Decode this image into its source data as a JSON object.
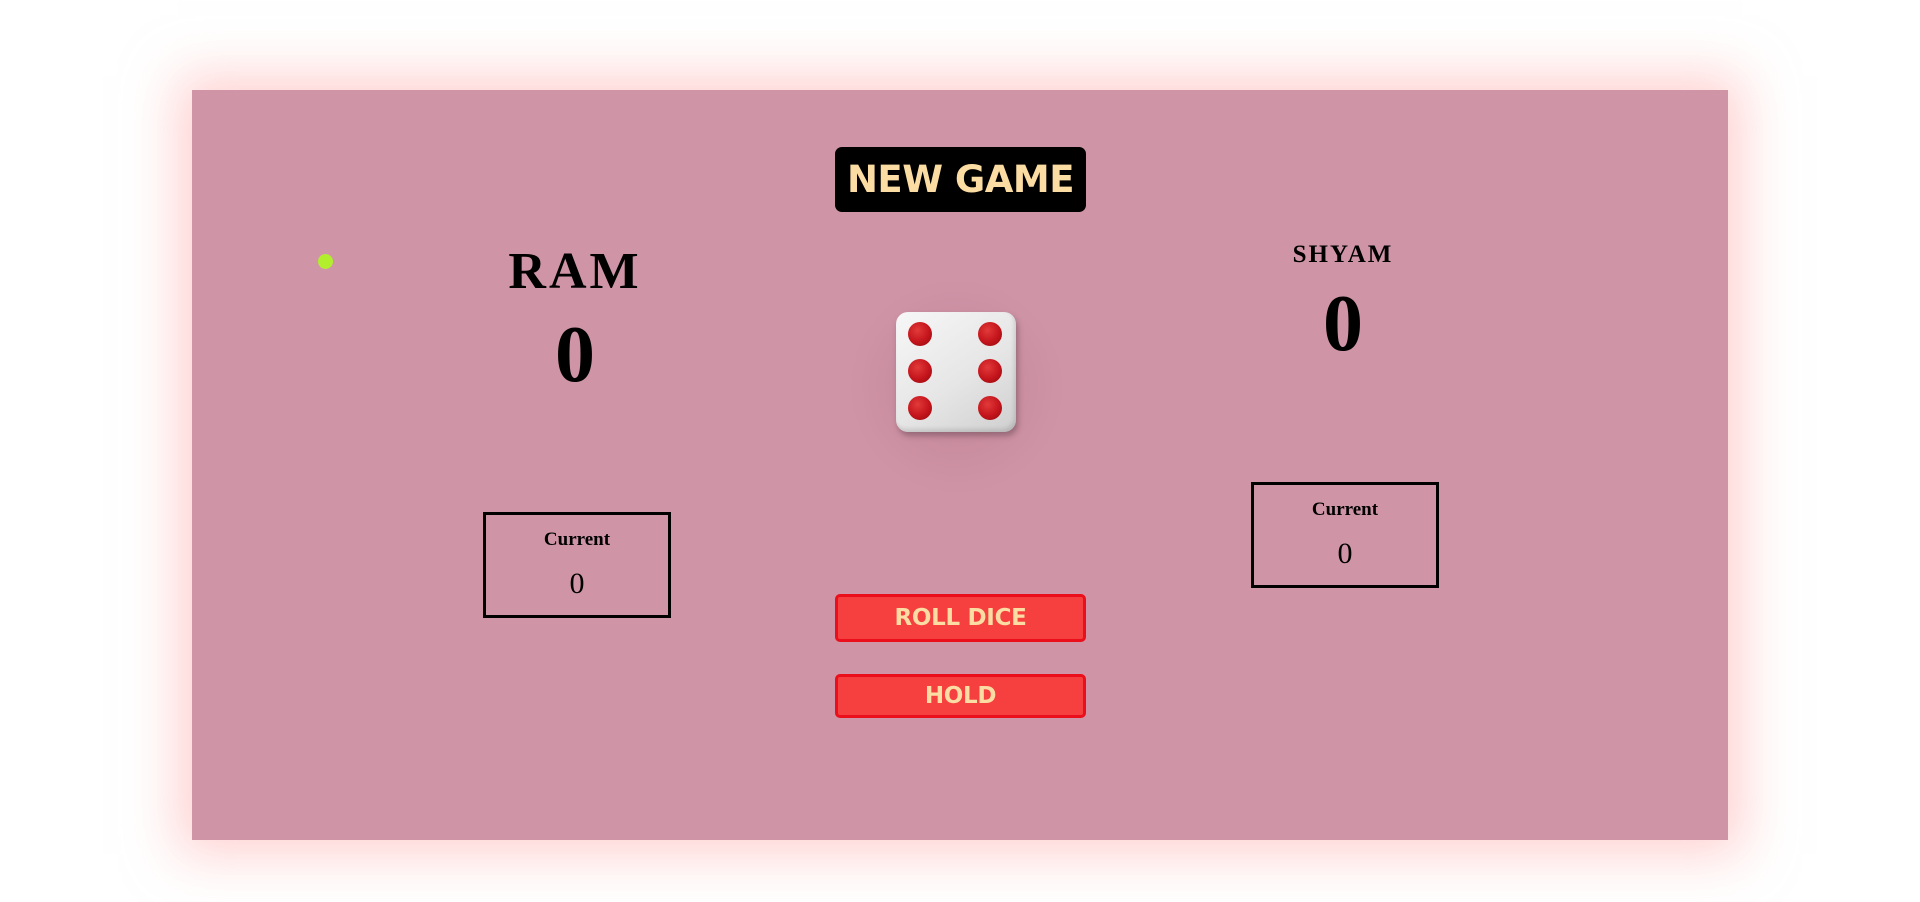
{
  "controls": {
    "new_game_label": "NEW GAME",
    "roll_dice_label": "ROLL DICE",
    "hold_label": "HOLD"
  },
  "players": [
    {
      "name": "RAM",
      "score": "0",
      "current_label": "Current",
      "current_value": "0",
      "active": true
    },
    {
      "name": "SHYAM",
      "score": "0",
      "current_label": "Current",
      "current_value": "0",
      "active": false
    }
  ],
  "dice": {
    "value": 6,
    "icon": "dice-six-icon",
    "pip_color": "#c3141b"
  },
  "colors": {
    "panel_background": "#cf95a7",
    "active_indicator": "#b2ee2e",
    "button_red": "#f64040",
    "button_text": "#fbdca3"
  }
}
